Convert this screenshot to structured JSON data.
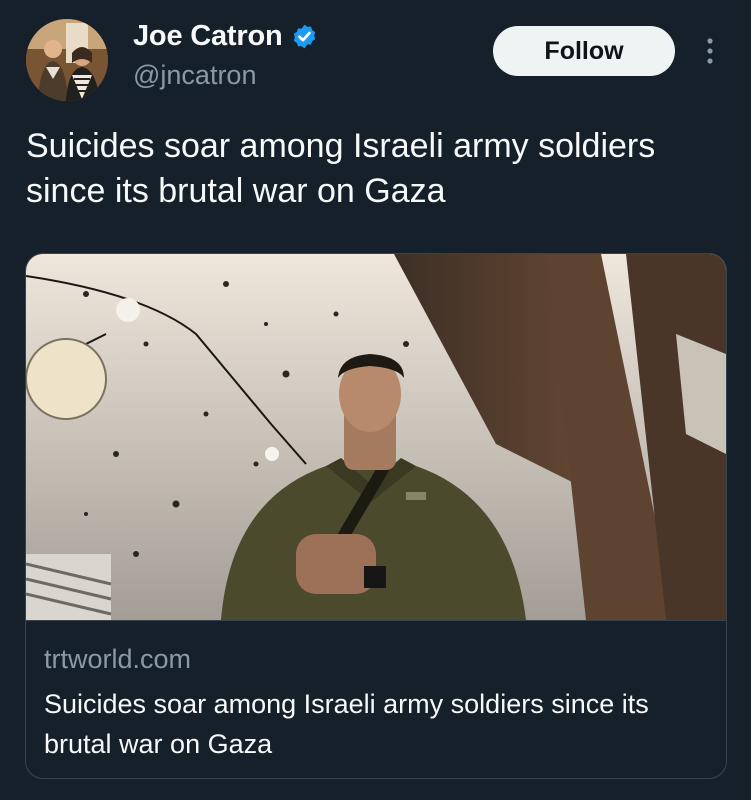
{
  "author": {
    "name": "Joe Catron",
    "handle": "@jncatron",
    "verified": true,
    "avatar_icon": "profile-photo",
    "badge_color": "#1d9bf0"
  },
  "actions": {
    "follow_label": "Follow",
    "more_icon": "more-vertical-icon"
  },
  "tweet": {
    "text": "Suicides soar among Israeli army soldiers since its brutal war on Gaza"
  },
  "link_card": {
    "image_icon": "soldier-photo",
    "domain": "trtworld.com",
    "title": "Suicides soar among Israeli army soldiers since its brutal war on Gaza"
  },
  "colors": {
    "background": "#15202b",
    "text_primary": "#f7f9f9",
    "text_secondary": "#8b98a5",
    "border": "#38444d",
    "follow_bg": "#eff3f4"
  }
}
